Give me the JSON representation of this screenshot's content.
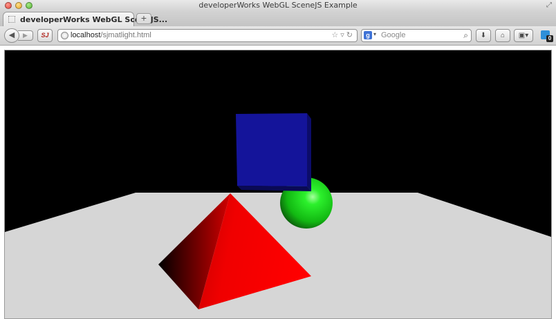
{
  "window": {
    "title": "developerWorks WebGL SceneJS Example"
  },
  "tabs": [
    {
      "label": "developerWorks WebGL SceneJS...",
      "active": true
    }
  ],
  "newtab_label": "+",
  "navbar": {
    "url_host": "localhost",
    "url_path": "/sjmatlight.html",
    "search_placeholder": "Google",
    "search_engine_icon": "google-icon",
    "sync_badge": "0"
  },
  "scene": {
    "background_color": "#000000",
    "floor_color": "#d6d6d6",
    "objects": [
      {
        "name": "cube",
        "color": "#1414a0"
      },
      {
        "name": "sphere",
        "color": "#1ee51e"
      },
      {
        "name": "pyramid",
        "color": "#ff0000"
      }
    ]
  }
}
